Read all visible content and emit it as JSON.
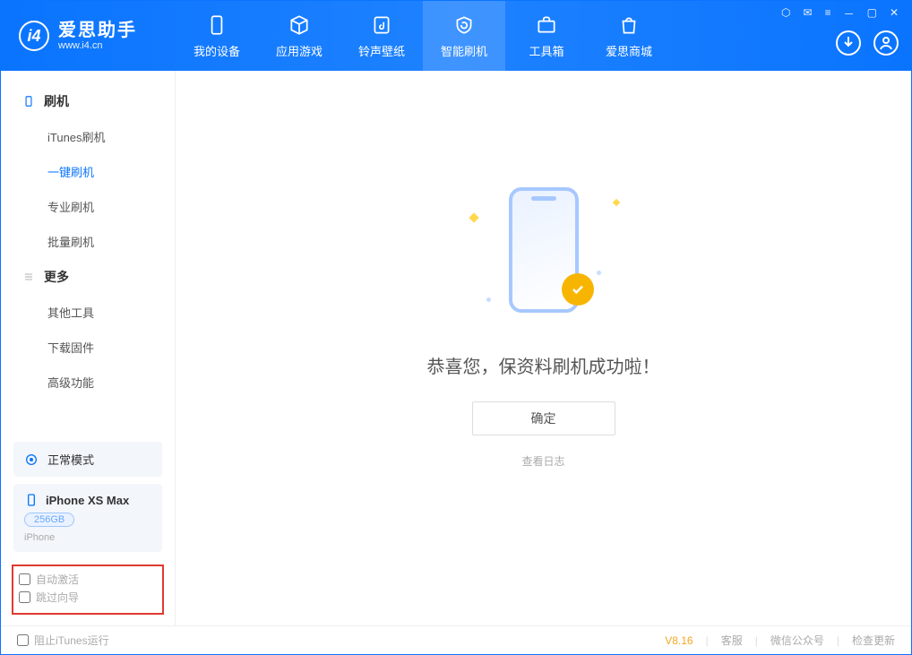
{
  "brand": {
    "name": "爱思助手",
    "url": "www.i4.cn"
  },
  "tabs": [
    {
      "id": "device",
      "label": "我的设备"
    },
    {
      "id": "apps",
      "label": "应用游戏"
    },
    {
      "id": "media",
      "label": "铃声壁纸"
    },
    {
      "id": "flash",
      "label": "智能刷机",
      "active": true
    },
    {
      "id": "toolbox",
      "label": "工具箱"
    },
    {
      "id": "store",
      "label": "爱思商城"
    }
  ],
  "sidebar": {
    "group1_title": "刷机",
    "group1": [
      {
        "id": "itunes",
        "label": "iTunes刷机"
      },
      {
        "id": "oneclick",
        "label": "一键刷机",
        "active": true
      },
      {
        "id": "pro",
        "label": "专业刷机"
      },
      {
        "id": "batch",
        "label": "批量刷机"
      }
    ],
    "group2_title": "更多",
    "group2": [
      {
        "id": "other",
        "label": "其他工具"
      },
      {
        "id": "firmware",
        "label": "下载固件"
      },
      {
        "id": "advanced",
        "label": "高级功能"
      }
    ]
  },
  "device_panel": {
    "mode": "正常模式",
    "name": "iPhone XS Max",
    "storage": "256GB",
    "platform": "iPhone"
  },
  "bottom_options": {
    "auto_activate": "自动激活",
    "skip_wizard": "跳过向导"
  },
  "main": {
    "success_title": "恭喜您，保资料刷机成功啦！",
    "ok_label": "确定",
    "log_link": "查看日志"
  },
  "statusbar": {
    "block_itunes": "阻止iTunes运行",
    "version": "V8.16",
    "links": [
      "客服",
      "微信公众号",
      "检查更新"
    ]
  }
}
